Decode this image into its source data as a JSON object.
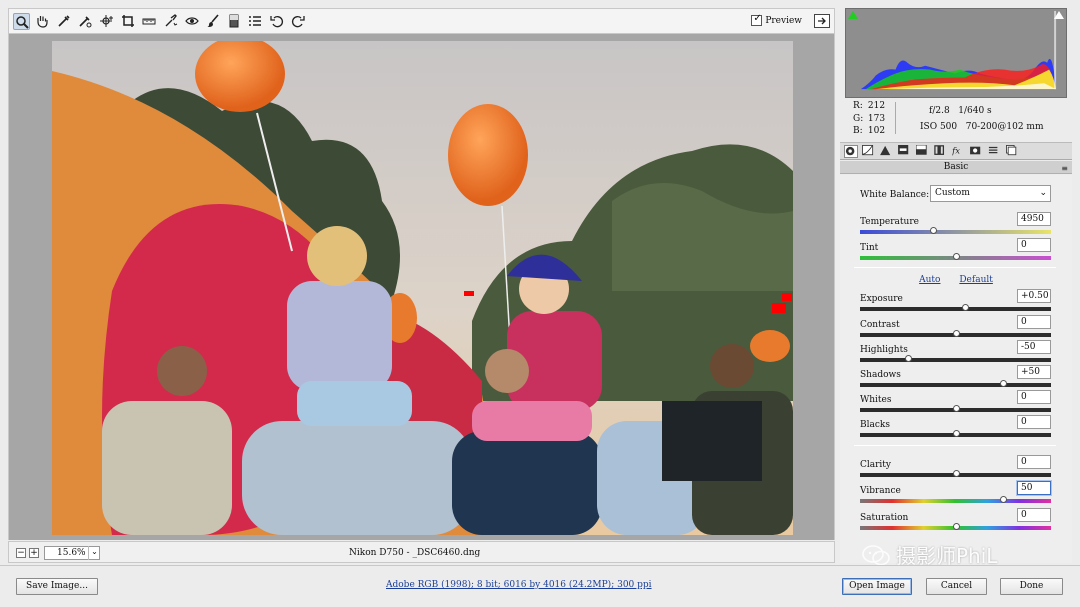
{
  "toolbar": {
    "tools": [
      "zoom-tool-icon",
      "hand-tool-icon",
      "white-balance-tool-icon",
      "color-sampler-icon",
      "targeted-adjustment-icon",
      "crop-tool-icon",
      "straighten-tool-icon",
      "spot-removal-icon",
      "red-eye-icon",
      "adjustment-brush-icon",
      "graduated-filter-icon",
      "preferences-icon",
      "rotate-ccw-icon",
      "rotate-cw-icon"
    ],
    "preview_label": "Preview"
  },
  "info": {
    "r_label": "R:",
    "r_value": "212",
    "g_label": "G:",
    "g_value": "173",
    "b_label": "B:",
    "b_value": "102",
    "exif_line1": "f/2.8   1/640 s",
    "exif_line2": "ISO 500   70-200@102 mm"
  },
  "panel": {
    "title": "Basic",
    "white_balance_label": "White Balance:",
    "white_balance_value": "Custom",
    "auto_label": "Auto",
    "default_label": "Default",
    "sliders": [
      {
        "key": "temperature",
        "label": "Temperature",
        "value": "4950",
        "pos": 0.38
      },
      {
        "key": "tint",
        "label": "Tint",
        "value": "0",
        "pos": 0.5
      },
      {
        "key": "exposure",
        "label": "Exposure",
        "value": "+0.50",
        "pos": 0.55
      },
      {
        "key": "contrast",
        "label": "Contrast",
        "value": "0",
        "pos": 0.5
      },
      {
        "key": "highlights",
        "label": "Highlights",
        "value": "-50",
        "pos": 0.25
      },
      {
        "key": "shadows",
        "label": "Shadows",
        "value": "+50",
        "pos": 0.75
      },
      {
        "key": "whites",
        "label": "Whites",
        "value": "0",
        "pos": 0.5
      },
      {
        "key": "blacks",
        "label": "Blacks",
        "value": "0",
        "pos": 0.5
      },
      {
        "key": "clarity",
        "label": "Clarity",
        "value": "0",
        "pos": 0.5
      },
      {
        "key": "vibrance",
        "label": "Vibrance",
        "value": "50",
        "pos": 0.75
      },
      {
        "key": "saturation",
        "label": "Saturation",
        "value": "0",
        "pos": 0.5
      }
    ]
  },
  "status": {
    "zoom_value": "15.6%",
    "filename": "Nikon D750  -  _DSC6460.dng"
  },
  "bottom": {
    "save_label": "Save Image...",
    "workflow_link": "Adobe RGB (1998); 8 bit; 6016 by 4016 (24.2MP); 300 ppi",
    "open_label": "Open Image",
    "cancel_label": "Cancel",
    "done_label": "Done"
  },
  "watermark": "摄影师PhiL"
}
